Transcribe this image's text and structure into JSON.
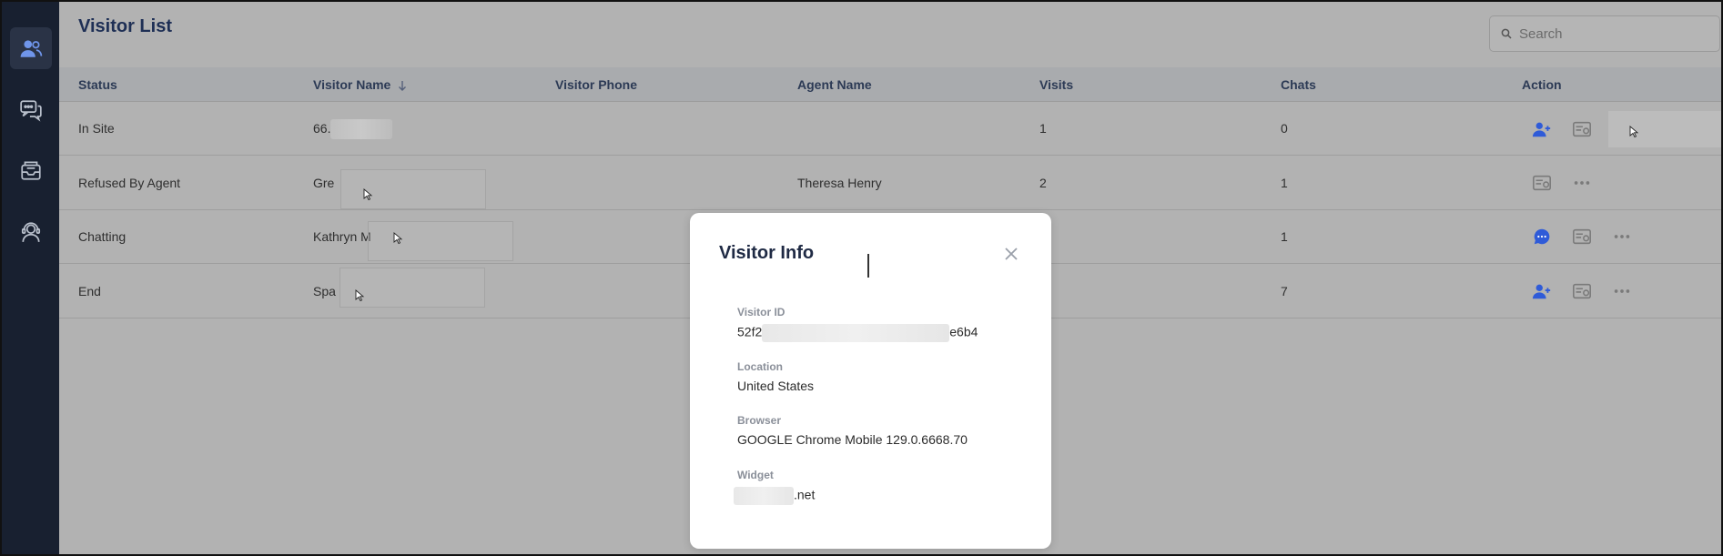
{
  "page": {
    "title": "Visitor List"
  },
  "search": {
    "placeholder": "Search"
  },
  "colors": {
    "accent": "#2f5bd8",
    "sidebar": "#182030",
    "title": "#1e2f55"
  },
  "sidebar": {
    "items": [
      {
        "name": "visitors",
        "icon": "users-icon",
        "active": true
      },
      {
        "name": "chats",
        "icon": "chat-bubbles-icon",
        "active": false
      },
      {
        "name": "inbox",
        "icon": "inbox-icon",
        "active": false
      },
      {
        "name": "agents",
        "icon": "agent-headset-icon",
        "active": false
      }
    ]
  },
  "table": {
    "columns": {
      "status": "Status",
      "visitor_name": "Visitor Name",
      "visitor_phone": "Visitor Phone",
      "agent_name": "Agent Name",
      "visits": "Visits",
      "chats": "Chats",
      "action": "Action"
    },
    "sort": {
      "column": "visitor_name",
      "direction": "desc"
    },
    "rows": [
      {
        "status": "In Site",
        "visitor_name": "66.",
        "visitor_phone": "",
        "agent_name": "",
        "visits": "1",
        "chats": "0",
        "actions": [
          "add-user-icon",
          "id-card-icon"
        ]
      },
      {
        "status": "Refused By Agent",
        "visitor_name": "Gre",
        "visitor_phone": "",
        "agent_name": "Theresa Henry",
        "visits": "2",
        "chats": "1",
        "actions": [
          "id-card-icon",
          "more-icon"
        ]
      },
      {
        "status": "Chatting",
        "visitor_name": "Kathryn M",
        "visitor_phone": "",
        "agent_name": "",
        "visits": "",
        "chats": "1",
        "actions": [
          "chat-icon",
          "id-card-icon",
          "more-icon"
        ]
      },
      {
        "status": "End",
        "visitor_name": "Spa",
        "visitor_phone": "",
        "agent_name": "",
        "visits": "",
        "chats": "7",
        "actions": [
          "add-user-icon",
          "id-card-icon",
          "more-icon"
        ]
      }
    ]
  },
  "modal": {
    "title": "Visitor Info",
    "fields": {
      "visitor_id": {
        "label": "Visitor ID",
        "prefix": "52f2",
        "suffix": "e6b4"
      },
      "location": {
        "label": "Location",
        "value": "United States"
      },
      "browser": {
        "label": "Browser",
        "value": "GOOGLE Chrome Mobile 129.0.6668.70"
      },
      "widget": {
        "label": "Widget",
        "suffix": ".net"
      }
    }
  }
}
